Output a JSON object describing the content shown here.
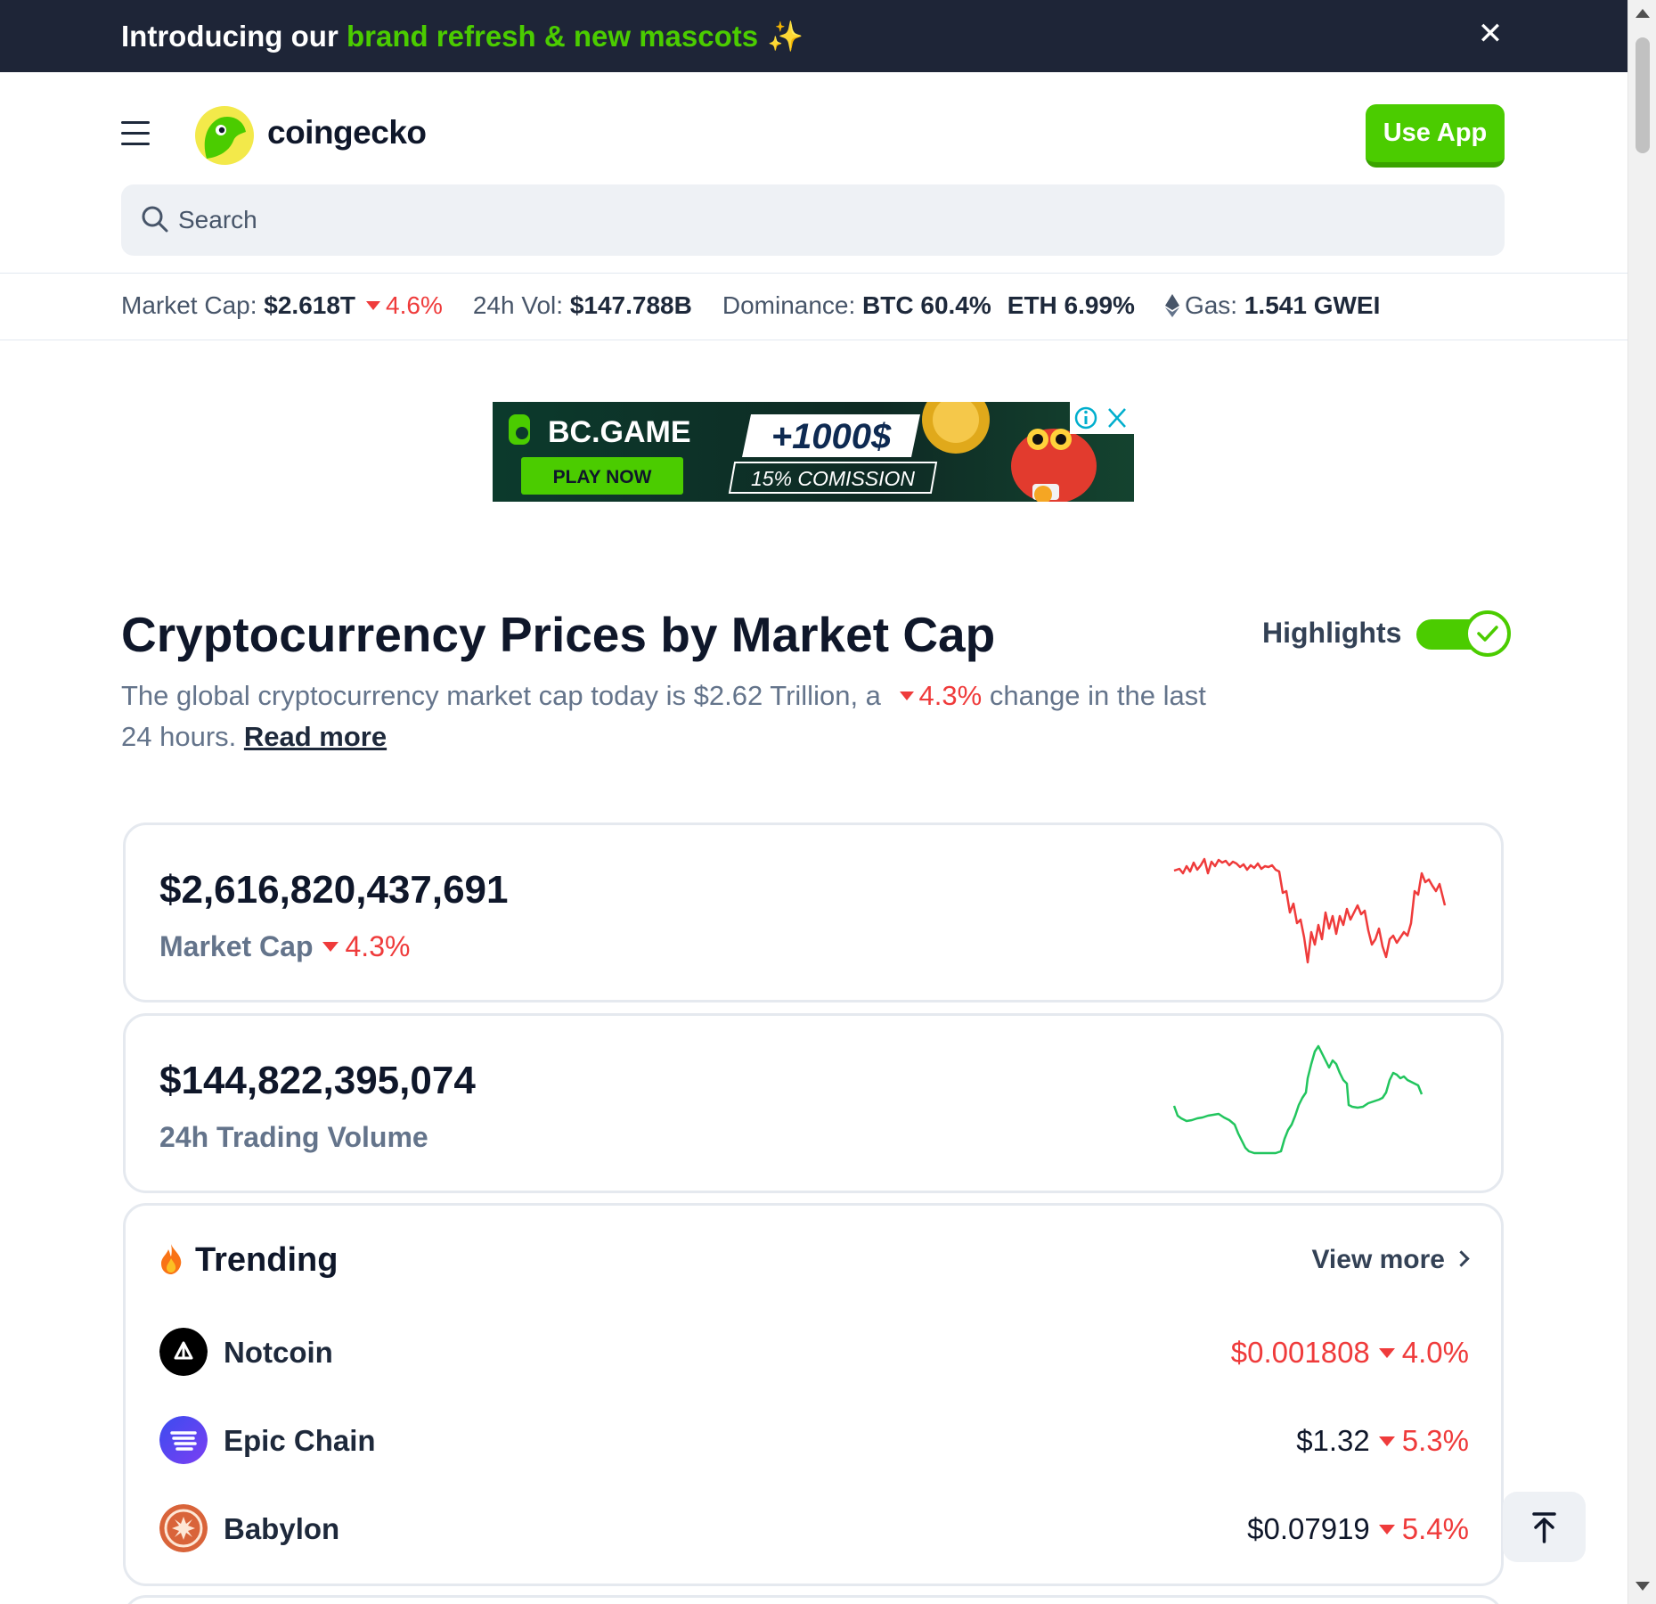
{
  "announcement": {
    "prefix": "Introducing our",
    "highlight": "brand refresh & new mascots",
    "emoji": "✨",
    "close_glyph": "✕"
  },
  "header": {
    "brand": "coingecko",
    "use_app_label": "Use App",
    "search_placeholder": "Search"
  },
  "stats": {
    "market_cap_label": "Market Cap:",
    "market_cap_value": "$2.618T",
    "market_cap_change": "4.6%",
    "vol_label": "24h Vol:",
    "vol_value": "$147.788B",
    "dominance_label": "Dominance:",
    "btc_dom": "BTC 60.4%",
    "eth_dom": "ETH 6.99%",
    "gas_label": "Gas:",
    "gas_value": "1.541 GWEI"
  },
  "ad": {
    "brand": "BC.GAME",
    "cta": "PLAY NOW",
    "bonus": "+1000$",
    "commission": "15% COMISSION"
  },
  "page": {
    "title": "Cryptocurrency Prices by Market Cap",
    "subtitle_before": "The global cryptocurrency market cap today is $2.62 Trillion, a",
    "subtitle_change": "4.3%",
    "subtitle_after": "change in the last 24 hours.",
    "read_more": "Read more",
    "highlights_label": "Highlights",
    "highlights_on": true
  },
  "cards": {
    "market_cap": {
      "value": "$2,616,820,437,691",
      "label": "Market Cap",
      "change": "4.3%"
    },
    "volume": {
      "value": "$144,822,395,074",
      "label": "24h Trading Volume"
    }
  },
  "trending": {
    "title": "Trending",
    "view_more": "View more",
    "items": [
      {
        "name": "Notcoin",
        "price": "$0.001808",
        "change": "4.0%",
        "icon": "notcoin-icon"
      },
      {
        "name": "Epic Chain",
        "price": "$1.32",
        "change": "5.3%",
        "icon": "epic-chain-icon"
      },
      {
        "name": "Babylon",
        "price": "$0.07919",
        "change": "5.4%",
        "icon": "babylon-icon"
      }
    ]
  },
  "colors": {
    "brand_green": "#4bcc00",
    "negative_red": "#ef3b3b",
    "dark_bar": "#1e2537"
  }
}
